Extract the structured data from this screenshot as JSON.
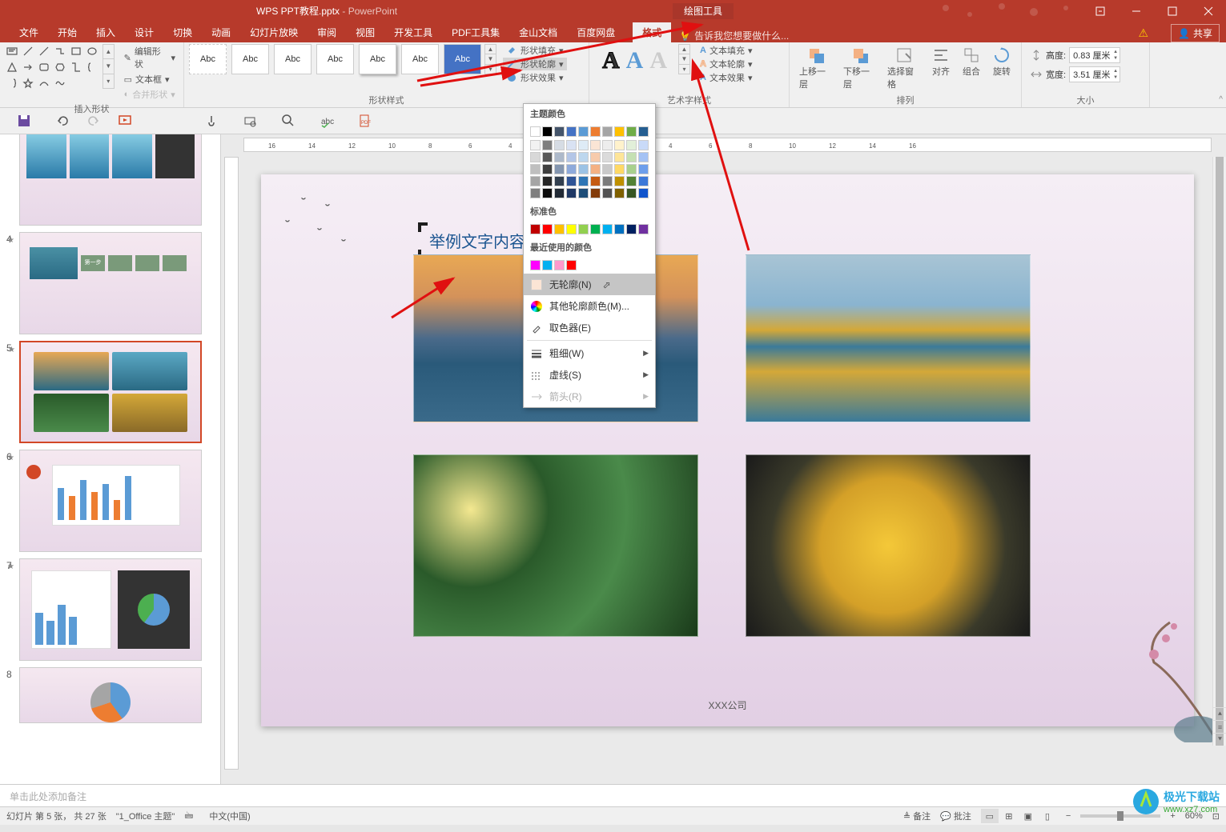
{
  "title": {
    "doc": "WPS PPT教程.pptx",
    "app": "PowerPoint"
  },
  "tool_tab": "绘图工具",
  "tabs": [
    "文件",
    "开始",
    "插入",
    "设计",
    "切换",
    "动画",
    "幻灯片放映",
    "审阅",
    "视图",
    "开发工具",
    "PDF工具集",
    "金山文档",
    "百度网盘"
  ],
  "format_tab": "格式",
  "tellme": "告诉我您想要做什么...",
  "share_label": "共享",
  "ribbon": {
    "insert_shapes": {
      "label": "插入形状",
      "edit": "编辑形状",
      "textbox": "文本框",
      "merge": "合并形状"
    },
    "shape_styles": {
      "label": "形状样式",
      "abc": "Abc",
      "fill": "形状填充",
      "outline": "形状轮廓",
      "effects": "形状效果"
    },
    "text_options": {
      "fill": "文本填充",
      "outline": "文本轮廓",
      "effects": "文本效果"
    },
    "wordart": {
      "label": "艺术字样式"
    },
    "arrange": {
      "label": "排列",
      "forward": "上移一层",
      "backward": "下移一层",
      "pane": "选择窗格",
      "align": "对齐",
      "group": "组合",
      "rotate": "旋转"
    },
    "size": {
      "label": "大小",
      "height": "高度:",
      "width": "宽度:",
      "h_val": "0.83 厘米",
      "w_val": "3.51 厘米"
    }
  },
  "dropdown": {
    "theme_colors": "主题颜色",
    "standard_colors": "标准色",
    "recent_colors": "最近使用的颜色",
    "no_outline": "无轮廓(N)",
    "more_colors": "其他轮廓颜色(M)...",
    "eyedropper": "取色器(E)",
    "weight": "粗细(W)",
    "dashes": "虚线(S)",
    "arrows": "箭头(R)",
    "theme_palette_row0": [
      "#ffffff",
      "#000000",
      "#44546a",
      "#4472c4",
      "#5b9bd5",
      "#ed7d31",
      "#a5a5a5",
      "#ffc000",
      "#70ad47",
      "#255e91"
    ],
    "theme_palette_rows": [
      [
        "#f2f2f2",
        "#7f7f7f",
        "#d6dce4",
        "#d9e2f3",
        "#deebf6",
        "#fbe5d5",
        "#ededed",
        "#fff2cc",
        "#e2efd9",
        "#c9daf8"
      ],
      [
        "#d8d8d8",
        "#595959",
        "#adb9ca",
        "#b4c6e7",
        "#bdd7ee",
        "#f7cbac",
        "#dbdbdb",
        "#fee599",
        "#c5e0b3",
        "#a4c2f4"
      ],
      [
        "#bfbfbf",
        "#3f3f3f",
        "#8496b0",
        "#8eaadb",
        "#9cc3e5",
        "#f4b183",
        "#c9c9c9",
        "#ffd965",
        "#a8d08d",
        "#6d9eeb"
      ],
      [
        "#a5a5a5",
        "#262626",
        "#323f4f",
        "#2f5496",
        "#2e75b5",
        "#c55a11",
        "#7b7b7b",
        "#bf9000",
        "#538135",
        "#3c78d8"
      ],
      [
        "#7f7f7f",
        "#0c0c0c",
        "#222a35",
        "#1f3864",
        "#1e4e79",
        "#833c0b",
        "#525252",
        "#7f6000",
        "#375623",
        "#1155cc"
      ]
    ],
    "standard_palette": [
      "#c00000",
      "#ff0000",
      "#ffc000",
      "#ffff00",
      "#92d050",
      "#00b050",
      "#00b0f0",
      "#0070c0",
      "#002060",
      "#7030a0"
    ],
    "recent_palette": [
      "#ff00ff",
      "#00b0f0",
      "#ff99cc",
      "#ff0000"
    ]
  },
  "slide": {
    "text": "举例文字内容",
    "company": "XXX公司"
  },
  "thumbs": [
    4,
    5,
    6,
    7,
    8
  ],
  "notes_placeholder": "单击此处添加备注",
  "status": {
    "slide": "幻灯片 第 5 张， 共 27 张",
    "theme": "\"1_Office 主题\"",
    "ime": "中文(中国)",
    "notes": "备注",
    "comments": "批注",
    "zoom": "60%"
  },
  "watermark": {
    "brand": "极光下载站",
    "url": "www.xz7.com"
  }
}
